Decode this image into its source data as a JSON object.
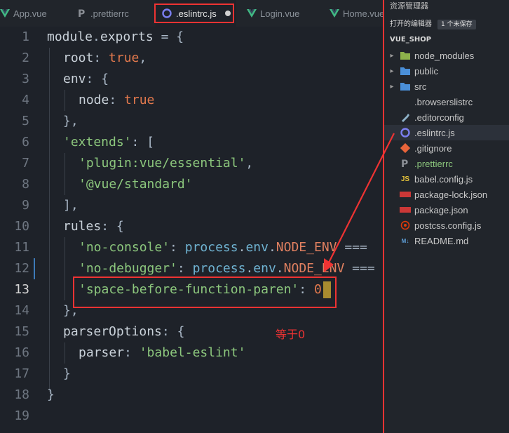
{
  "tabs": [
    {
      "label": "App.vue",
      "icon": "vue-icon"
    },
    {
      "label": ".prettierrc",
      "icon": "prettier-icon"
    },
    {
      "label": ".eslintrc.js",
      "icon": "eslint-icon",
      "active": true,
      "modified": true
    },
    {
      "label": "Login.vue",
      "icon": "vue-icon"
    },
    {
      "label": "Home.vue",
      "icon": "vue-icon"
    }
  ],
  "code": {
    "line_numbers": [
      "1",
      "2",
      "3",
      "4",
      "5",
      "6",
      "7",
      "8",
      "9",
      "10",
      "11",
      "12",
      "13",
      "14",
      "15",
      "16",
      "17",
      "18",
      "19"
    ],
    "current_line": "13",
    "lines": {
      "l1": {
        "a": "module",
        "b": ".",
        "c": "exports",
        "d": " = {"
      },
      "l2": {
        "a": "root",
        "b": ": ",
        "c": "true",
        "d": ","
      },
      "l3": {
        "a": "env",
        "b": ": {"
      },
      "l4": {
        "a": "node",
        "b": ": ",
        "c": "true"
      },
      "l5": {
        "a": "},"
      },
      "l6": {
        "a": "'extends'",
        "b": ": ["
      },
      "l7": {
        "a": "'plugin:vue/essential'",
        "b": ","
      },
      "l8": {
        "a": "'@vue/standard'"
      },
      "l9": {
        "a": "],"
      },
      "l10": {
        "a": "rules",
        "b": ": {"
      },
      "l11": {
        "a": "'no-console'",
        "b": ": ",
        "c": "process",
        "d": ".",
        "e": "env",
        "f": ".",
        "g": "NODE_ENV",
        "h": " ==="
      },
      "l12": {
        "a": "'no-debugger'",
        "b": ": ",
        "c": "process",
        "d": ".",
        "e": "env",
        "f": ".",
        "g": "NODE_ENV",
        "h": " ==="
      },
      "l13": {
        "a": "'space-before-function-paren'",
        "b": ": ",
        "c": "0"
      },
      "l14": {
        "a": "},"
      },
      "l15": {
        "a": "parserOptions",
        "b": ": {"
      },
      "l16": {
        "a": "parser",
        "b": ": ",
        "c": "'babel-eslint'"
      },
      "l17": {
        "a": "}"
      },
      "l18": {
        "a": "}"
      }
    }
  },
  "annotation": "等于0",
  "explorer": {
    "title": "资源管理器",
    "open_editors_label": "打开的编辑器",
    "unsaved_badge": "1 个未保存",
    "root_label": "VUE_SHOP",
    "items": [
      {
        "label": "node_modules",
        "type": "folder",
        "icon": "folder-icon"
      },
      {
        "label": "public",
        "type": "folder",
        "icon": "folder-icon"
      },
      {
        "label": "src",
        "type": "folder",
        "icon": "folder-icon"
      },
      {
        "label": ".browserslistrc",
        "type": "file",
        "icon": "file-icon"
      },
      {
        "label": ".editorconfig",
        "type": "file",
        "icon": "editorconfig-icon"
      },
      {
        "label": ".eslintrc.js",
        "type": "file",
        "icon": "eslint-icon",
        "selected": true
      },
      {
        "label": ".gitignore",
        "type": "file",
        "icon": "git-icon"
      },
      {
        "label": ".prettierrc",
        "type": "file",
        "icon": "prettier-icon",
        "modified": true
      },
      {
        "label": "babel.config.js",
        "type": "file",
        "icon": "js-icon"
      },
      {
        "label": "package-lock.json",
        "type": "file",
        "icon": "npm-icon"
      },
      {
        "label": "package.json",
        "type": "file",
        "icon": "npm-icon"
      },
      {
        "label": "postcss.config.js",
        "type": "file",
        "icon": "postcss-icon"
      },
      {
        "label": "README.md",
        "type": "file",
        "icon": "markdown-icon"
      }
    ]
  },
  "colors": {
    "annotation_red": "#ee3333",
    "vue_green": "#41b883",
    "eslint_purple": "#7b7ff0",
    "folder_blue": "#4a8fd8"
  }
}
